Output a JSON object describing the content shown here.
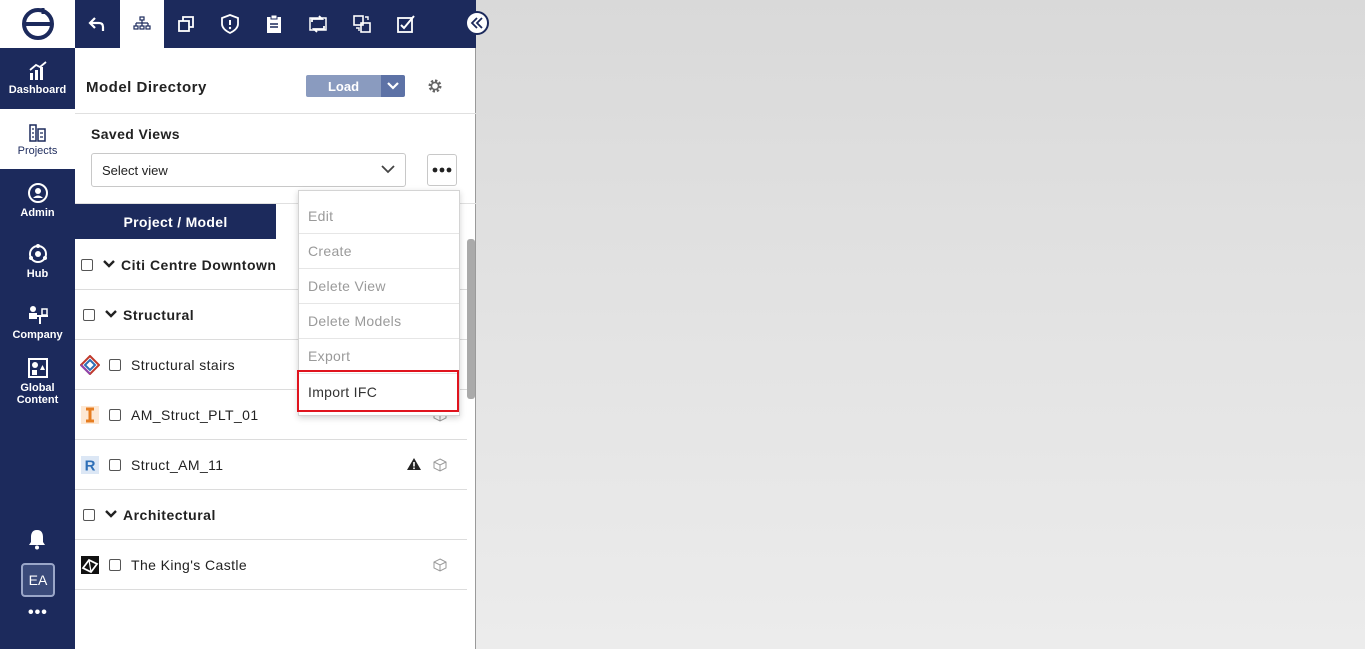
{
  "nav": {
    "items": [
      {
        "label": "Dashboard",
        "icon": "chart-icon"
      },
      {
        "label": "Projects",
        "icon": "buildings-icon"
      },
      {
        "label": "Admin",
        "icon": "admin-icon"
      },
      {
        "label": "Hub",
        "icon": "hub-icon"
      },
      {
        "label": "Company",
        "icon": "company-icon"
      },
      {
        "label": "Global Content",
        "icon": "global-content-icon"
      }
    ],
    "avatar": "EA",
    "more": "•••"
  },
  "toolbar": {
    "icons": [
      "back-arrow-icon",
      "hierarchy-icon",
      "copy-icon",
      "shield-icon",
      "clipboard-icon",
      "sync-icon",
      "compare-icon",
      "checklist-icon"
    ]
  },
  "panel": {
    "title": "Model Directory",
    "load_label": "Load",
    "saved_views_label": "Saved Views",
    "select_placeholder": "Select view",
    "tab_label": "Project / Model"
  },
  "tree": {
    "project": "Citi Centre Downtown",
    "groups": [
      {
        "name": "Structural",
        "files": [
          "Structural stairs",
          "AM_Struct_PLT_01",
          "Struct_AM_11"
        ]
      },
      {
        "name": "Architectural",
        "files": [
          "The King's Castle"
        ]
      }
    ]
  },
  "menu": {
    "items": [
      "Edit",
      "Create",
      "Delete View",
      "Delete Models",
      "Export",
      "Import IFC"
    ],
    "active": "Import IFC"
  },
  "colors": {
    "navy": "#1c2a5c",
    "load_button": "#8a9bbf",
    "highlight": "#e0141e"
  }
}
